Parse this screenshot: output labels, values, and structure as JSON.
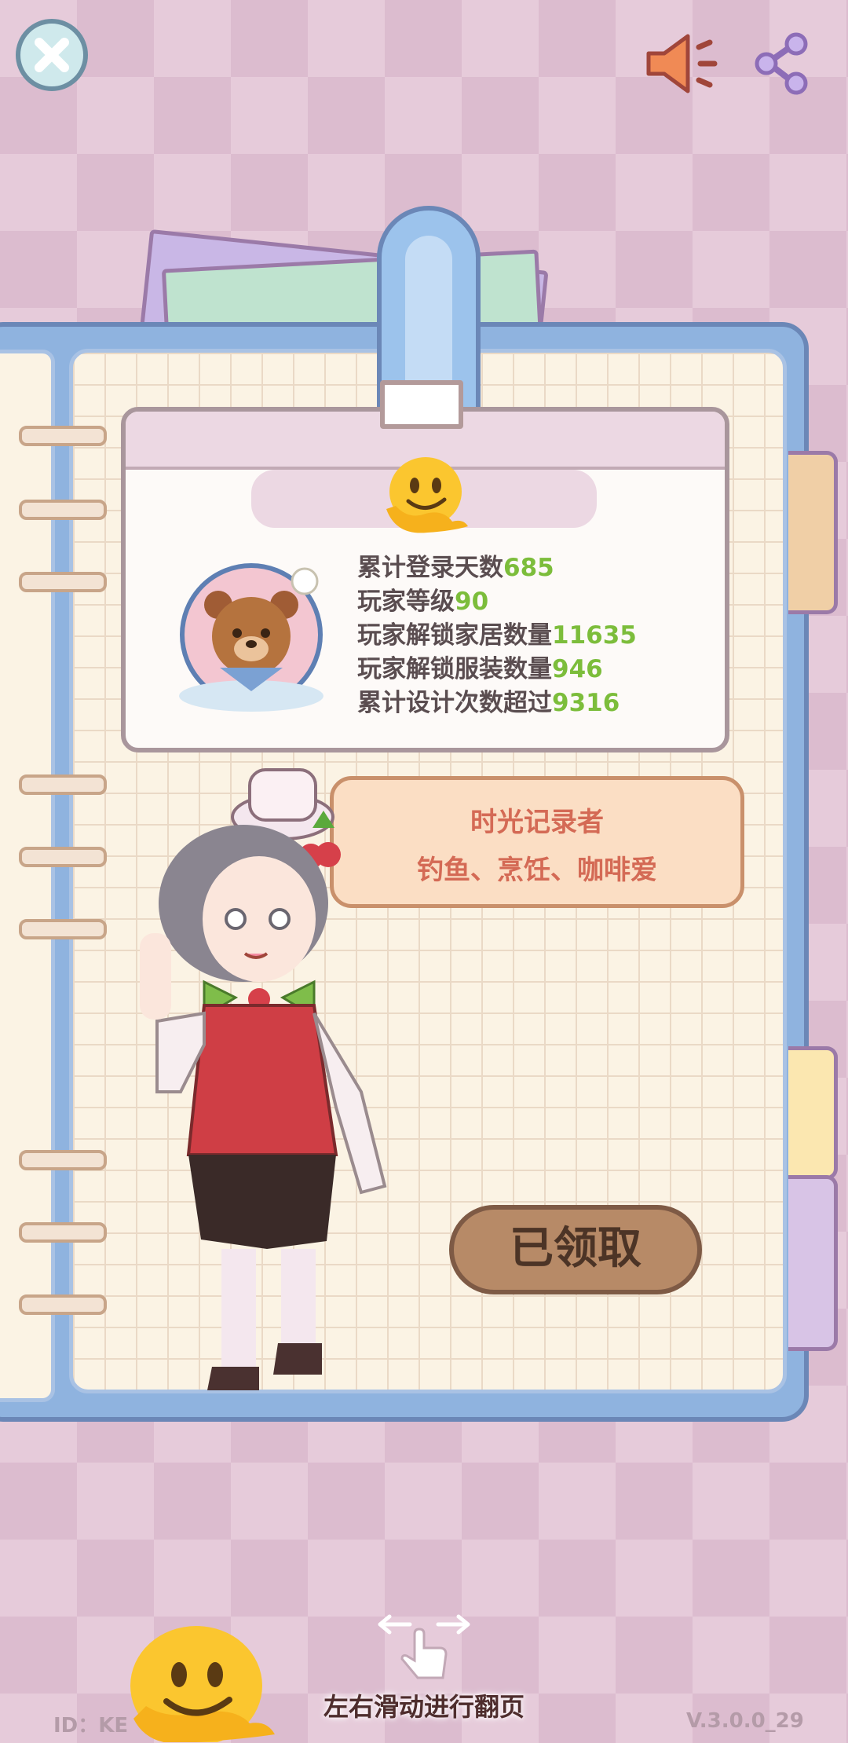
{
  "profile": {
    "stats": [
      {
        "label": "累计登录天数",
        "value": "685"
      },
      {
        "label": "玩家等级",
        "value": "90"
      },
      {
        "label": "玩家解锁家居数量",
        "value": "11635"
      },
      {
        "label": "玩家解锁服装数量",
        "value": "946"
      },
      {
        "label": "累计设计次数超过",
        "value": "9316"
      }
    ],
    "title": "时光记录者",
    "hobbies": "钓鱼、烹饪、咖啡爱"
  },
  "actions": {
    "claimed_label": "已领取"
  },
  "footer": {
    "swipe_hint": "左右滑动进行翻页",
    "id_label": "ID：KE",
    "version": "V.3.0.0_29"
  },
  "icons": {
    "close": "close-icon",
    "sound": "speaker-icon",
    "share": "share-icon",
    "badge": "bear-badge-icon",
    "emoji": "melting-face-emoji",
    "swipe": "swipe-hand-icon"
  }
}
